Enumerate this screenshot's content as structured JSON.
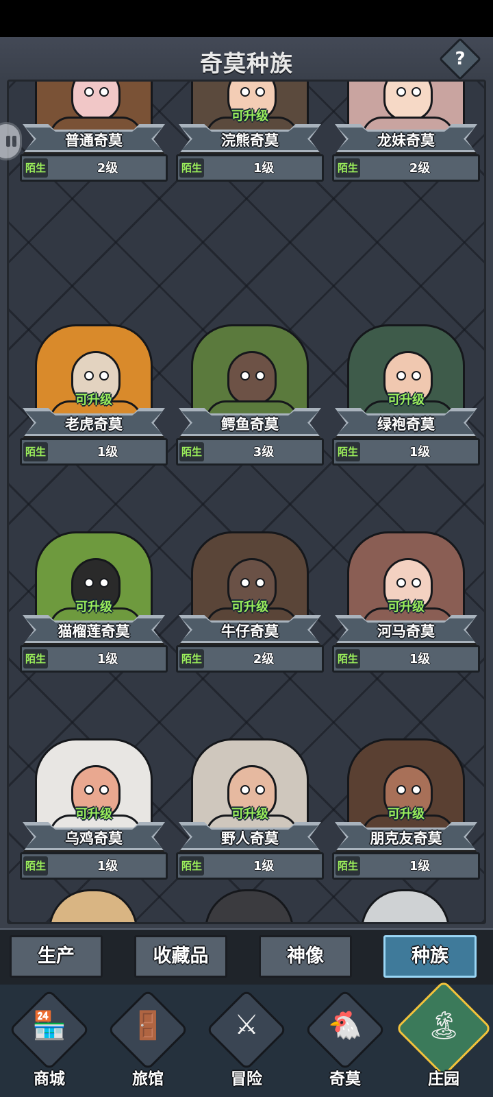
{
  "header": {
    "title": "奇莫种族",
    "help_label": "?"
  },
  "cards": [
    {
      "name": "普通奇莫",
      "status": "陌生",
      "level": "2级",
      "upgrade": "",
      "theme": "#7a5236",
      "skin": "#f1c7c7"
    },
    {
      "name": "浣熊奇莫",
      "status": "陌生",
      "level": "1级",
      "upgrade": "可升级",
      "theme": "#5b4a3d",
      "skin": "#f3cdb5"
    },
    {
      "name": "龙妹奇莫",
      "status": "陌生",
      "level": "2级",
      "upgrade": "",
      "theme": "#c9a4a0",
      "skin": "#f6d9c6"
    },
    {
      "name": "老虎奇莫",
      "status": "陌生",
      "level": "1级",
      "upgrade": "可升级",
      "theme": "#d98a2b",
      "skin": "#e3d3c0"
    },
    {
      "name": "鳄鱼奇莫",
      "status": "陌生",
      "level": "3级",
      "upgrade": "",
      "theme": "#5b7a3d",
      "skin": "#6d5246"
    },
    {
      "name": "绿袍奇莫",
      "status": "陌生",
      "level": "1级",
      "upgrade": "可升级",
      "theme": "#3e5b4a",
      "skin": "#f0c8b0"
    },
    {
      "name": "猫榴莲奇莫",
      "status": "陌生",
      "level": "1级",
      "upgrade": "可升级",
      "theme": "#6e9a3e",
      "skin": "#2a2a2a"
    },
    {
      "name": "牛仔奇莫",
      "status": "陌生",
      "level": "2级",
      "upgrade": "可升级",
      "theme": "#5a4538",
      "skin": "#6a5146"
    },
    {
      "name": "河马奇莫",
      "status": "陌生",
      "level": "1级",
      "upgrade": "可升级",
      "theme": "#8a5e54",
      "skin": "#f3d1c1"
    },
    {
      "name": "乌鸡奇莫",
      "status": "陌生",
      "level": "1级",
      "upgrade": "可升级",
      "theme": "#e8e6e3",
      "skin": "#e9a890"
    },
    {
      "name": "野人奇莫",
      "status": "陌生",
      "level": "1级",
      "upgrade": "可升级",
      "theme": "#cfc7bd",
      "skin": "#e6b9a0"
    },
    {
      "name": "朋克友奇莫",
      "status": "陌生",
      "level": "1级",
      "upgrade": "可升级",
      "theme": "#5a4032",
      "skin": "#a87058"
    }
  ],
  "peek_colors": [
    "#d9b583",
    "#3b3b3f",
    "#cfd2d4"
  ],
  "tabs": [
    {
      "label": "生产",
      "active": false
    },
    {
      "label": "收藏品",
      "active": false
    },
    {
      "label": "神像",
      "active": false
    },
    {
      "label": "种族",
      "active": true
    }
  ],
  "nav": [
    {
      "label": "商城",
      "icon": "shop-icon",
      "glyph": "🏪",
      "active": false
    },
    {
      "label": "旅馆",
      "icon": "inn-icon",
      "glyph": "🚪",
      "active": false
    },
    {
      "label": "冒险",
      "icon": "adventure-swords-icon",
      "glyph": "⚔",
      "active": false
    },
    {
      "label": "奇莫",
      "icon": "kimo-icon",
      "glyph": "🐔",
      "active": false
    },
    {
      "label": "庄园",
      "icon": "manor-island-icon",
      "glyph": "🏝",
      "active": true
    }
  ]
}
